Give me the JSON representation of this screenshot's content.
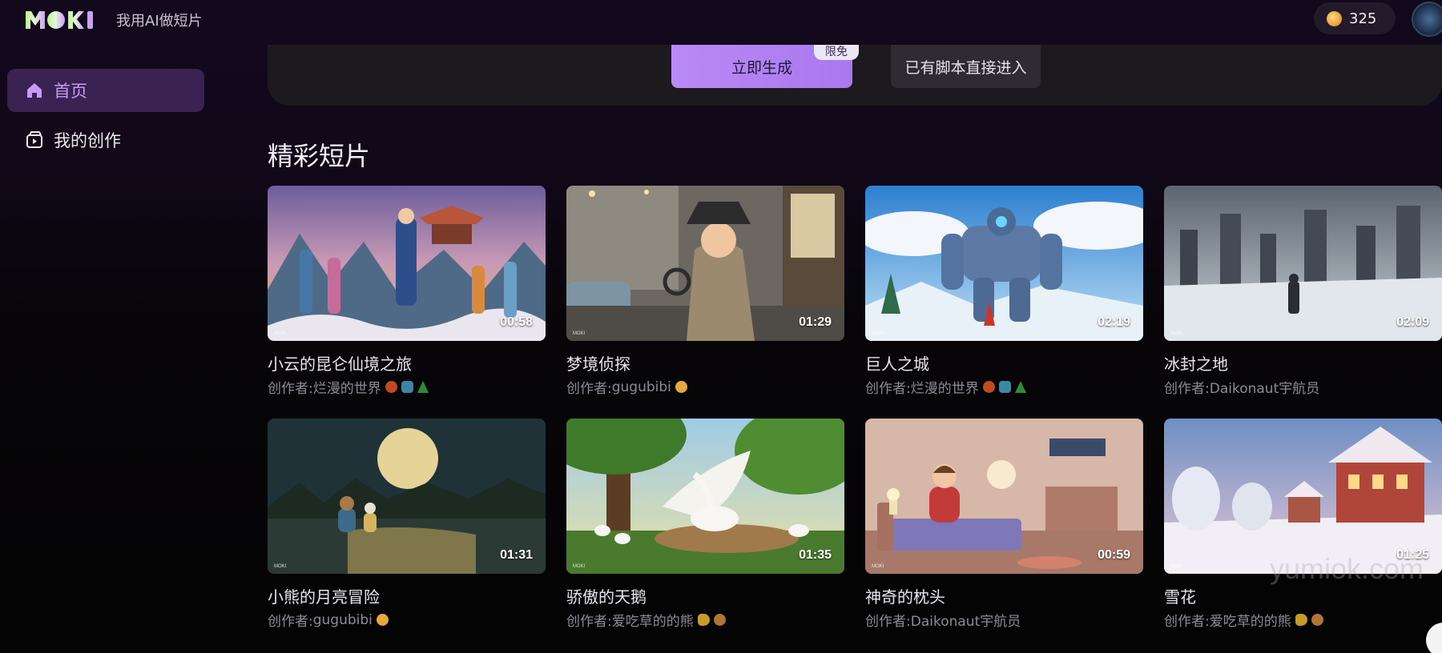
{
  "header": {
    "logo_text": "MOKI",
    "tagline": "我用AI做短片",
    "coins": "325"
  },
  "sidebar": {
    "items": [
      {
        "label": "首页",
        "icon": "home-icon",
        "active": true
      },
      {
        "label": "我的创作",
        "icon": "video-folder-icon",
        "active": false
      }
    ]
  },
  "hero": {
    "generate_label": "立即生成",
    "limited_badge": "限免",
    "script_label": "已有脚本直接进入"
  },
  "section": {
    "title": "精彩短片"
  },
  "author_prefix": "创作者: ",
  "cards": [
    {
      "title": "小云的昆仑仙境之旅",
      "author": "烂漫的世界",
      "duration": "00:58",
      "emojis": [
        "red",
        "blue",
        "tree"
      ]
    },
    {
      "title": "梦境侦探",
      "author": "gugubibi",
      "duration": "01:29",
      "emojis": [
        "smile"
      ]
    },
    {
      "title": "巨人之城",
      "author": "烂漫的世界",
      "duration": "02:19",
      "emojis": [
        "red",
        "blue",
        "tree"
      ]
    },
    {
      "title": "冰封之地",
      "author": "Daikonaut宇航员",
      "duration": "02:09",
      "emojis": []
    },
    {
      "title": "小熊的月亮冒险",
      "author": "gugubibi",
      "duration": "01:31",
      "emojis": [
        "smile"
      ]
    },
    {
      "title": "骄傲的天鹅",
      "author": "爱吃草的的熊",
      "duration": "01:35",
      "emojis": [
        "bee",
        "bear"
      ]
    },
    {
      "title": "神奇的枕头",
      "author": "Daikonaut宇航员",
      "duration": "00:59",
      "emojis": []
    },
    {
      "title": "雪花",
      "author": "爱吃草的的熊",
      "duration": "01:25",
      "emojis": [
        "bee",
        "bear"
      ]
    }
  ],
  "thumb_mark": "MOKI",
  "watermark": "yumiok.com",
  "colors": {
    "accent": "#b98af4",
    "sidebar_active_bg": "#3a2352",
    "sidebar_active_text": "#c79af7"
  }
}
